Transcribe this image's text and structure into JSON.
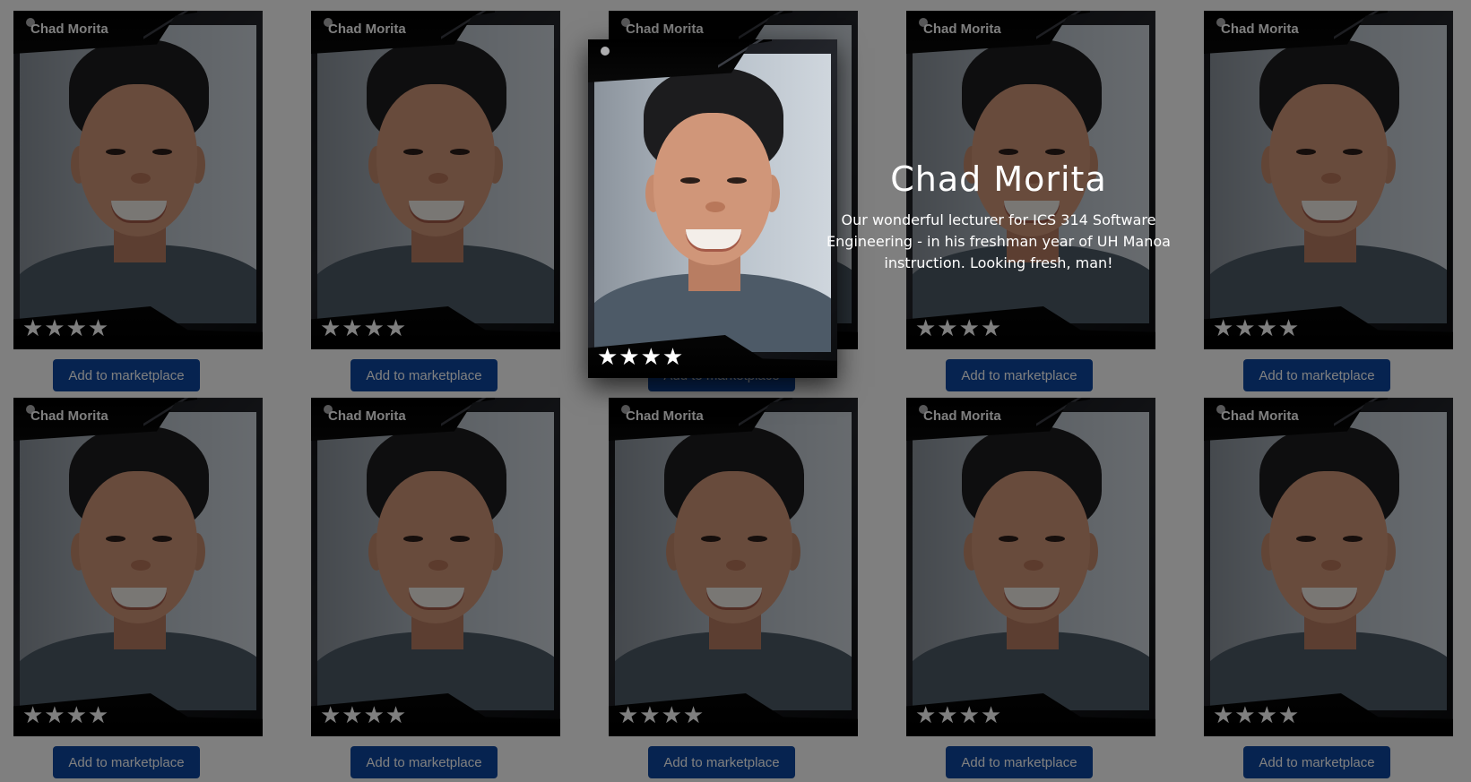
{
  "cards": [
    {
      "name": "Chad Morita",
      "rating": "★★★★",
      "button_label": "Add to marketplace"
    },
    {
      "name": "Chad Morita",
      "rating": "★★★★",
      "button_label": "Add to marketplace"
    },
    {
      "name": "Chad Morita",
      "rating": "★★★★",
      "button_label": "Add to marketplace"
    },
    {
      "name": "Chad Morita",
      "rating": "★★★★",
      "button_label": "Add to marketplace"
    },
    {
      "name": "Chad Morita",
      "rating": "★★★★",
      "button_label": "Add to marketplace"
    },
    {
      "name": "Chad Morita",
      "rating": "★★★★",
      "button_label": "Add to marketplace"
    },
    {
      "name": "Chad Morita",
      "rating": "★★★★",
      "button_label": "Add to marketplace"
    },
    {
      "name": "Chad Morita",
      "rating": "★★★★",
      "button_label": "Add to marketplace"
    },
    {
      "name": "Chad Morita",
      "rating": "★★★★",
      "button_label": "Add to marketplace"
    },
    {
      "name": "Chad Morita",
      "rating": "★★★★",
      "button_label": "Add to marketplace"
    }
  ],
  "focused_card": {
    "rating": "★★★★",
    "title": "Chad Morita",
    "description": "Our wonderful lecturer for ICS 314 Software Engineering - in his freshman year of UH Manoa instruction. Looking fresh, man!"
  },
  "colors": {
    "button_bg": "#0d47a1",
    "overlay": "rgba(0,0,0,0.5)"
  }
}
